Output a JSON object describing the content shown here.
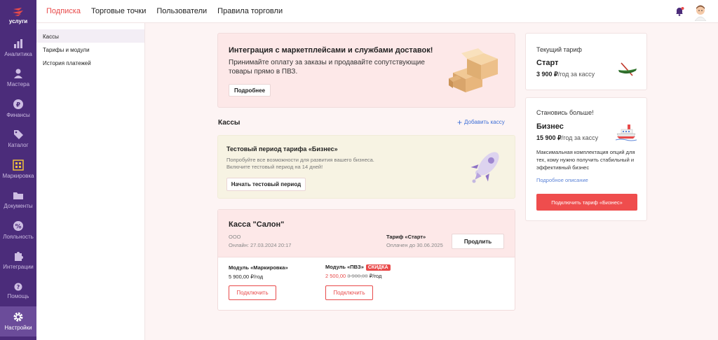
{
  "brand": {
    "logo_text": "услуги"
  },
  "rail": [
    {
      "label": "Аналитика",
      "icon": "bar-chart-icon"
    },
    {
      "label": "Мастера",
      "icon": "person-icon"
    },
    {
      "label": "Финансы",
      "icon": "ruble-icon"
    },
    {
      "label": "Каталог",
      "icon": "tag-icon"
    },
    {
      "label": "Маркировка",
      "icon": "qr-icon"
    },
    {
      "label": "Документы",
      "icon": "folder-icon"
    },
    {
      "label": "Лояльность",
      "icon": "percent-icon"
    },
    {
      "label": "Интеграции",
      "icon": "puzzle-icon"
    },
    {
      "label": "Помощь",
      "icon": "help-icon"
    },
    {
      "label": "Настройки",
      "icon": "gear-icon"
    }
  ],
  "topnav": {
    "tabs": [
      "Подписка",
      "Торговые точки",
      "Пользователи",
      "Правила торговли"
    ],
    "active_tab": "Подписка"
  },
  "subnav": [
    "Кассы",
    "Тарифы и модули",
    "История платежей"
  ],
  "promo": {
    "title": "Интеграция с маркетплейсами и службами доставок!",
    "text": "Принимайте оплату за заказы и продавайте сопутствующие товары прямо в ПВЗ.",
    "button": "Подробнее"
  },
  "kassy": {
    "title": "Кассы",
    "add_label": "Добавить кассу"
  },
  "trial": {
    "title": "Тестовый период тарифа «Бизнес»",
    "text_line1": "Попробуйте все возможности для развития вашего бизнеса.",
    "text_line2": "Включите тестовый период на 14 дней!",
    "button": "Начать тестовый период"
  },
  "kassa": {
    "name": "Касса \"Салон\"",
    "org": "ООО",
    "online": "Онлайн: 27.03.2024 20:17",
    "tariff_label": "Тариф «Старт»",
    "paid_until": "Оплачен до 30.06.2025",
    "prolong_button": "Продлить",
    "modules": [
      {
        "name": "Модуль «Маркировка»",
        "price": "5 900,00 ₽/год",
        "button": "Подключить"
      },
      {
        "name": "Модуль «ПВЗ»",
        "badge": "СКИДКА",
        "price_new": "2 500,00",
        "price_old": "3 900,00",
        "price_unit": "₽/год",
        "button": "Подключить"
      }
    ]
  },
  "current_tariff": {
    "label": "Текущий тариф",
    "name": "Старт",
    "price_value": "3 900 ₽",
    "price_unit": "/год за кассу"
  },
  "upgrade": {
    "label": "Становись больше!",
    "name": "Бизнес",
    "price_value": "15 900 ₽",
    "price_unit": "/год за кассу",
    "description": "Максимальная комплектация опций для тех, кому нужно получить стабильный и эффективный бизнес",
    "link": "Подробное описание",
    "button": "Подключить тариф «Бизнес»"
  },
  "colors": {
    "accent": "#e84a4a",
    "rail": "#4b2c7a",
    "link": "#3f6fd6"
  }
}
